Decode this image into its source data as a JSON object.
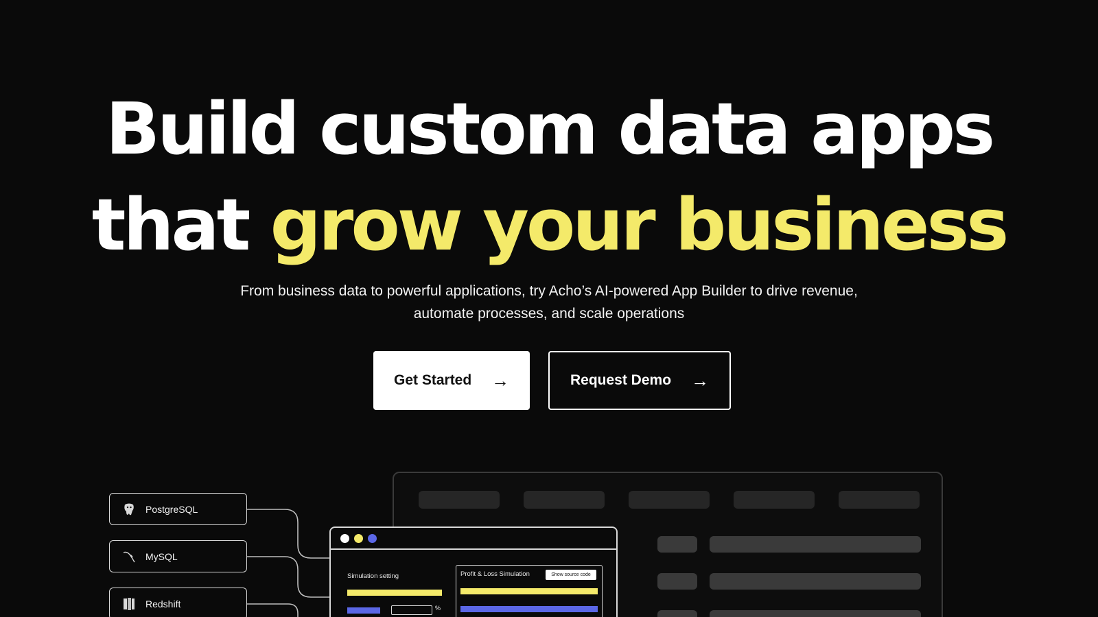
{
  "hero": {
    "title_line1": "Build custom data apps",
    "title_line2_plain": "that ",
    "title_line2_accent": "grow your business",
    "subtitle_line1": "From business data to powerful applications, try Acho’s AI-powered App Builder to drive revenue,",
    "subtitle_line2": "automate processes, and scale operations"
  },
  "cta": {
    "primary_label": "Get Started",
    "secondary_label": "Request Demo",
    "arrow": "→"
  },
  "sources": [
    {
      "label": "PostgreSQL",
      "icon": "postgresql-icon"
    },
    {
      "label": "MySQL",
      "icon": "mysql-icon"
    },
    {
      "label": "Redshift",
      "icon": "redshift-icon"
    }
  ],
  "app_window": {
    "dots": [
      "#ffffff",
      "#f4ea6a",
      "#5b67e6"
    ],
    "simulation_label": "Simulation setting",
    "panel_title": "Profit & Loss Simulation",
    "show_source_label": "Show source code",
    "percent_symbol": "%"
  },
  "colors": {
    "background": "#0a0a0a",
    "accent_yellow": "#f4ea6a",
    "accent_blue": "#5b67e6"
  }
}
